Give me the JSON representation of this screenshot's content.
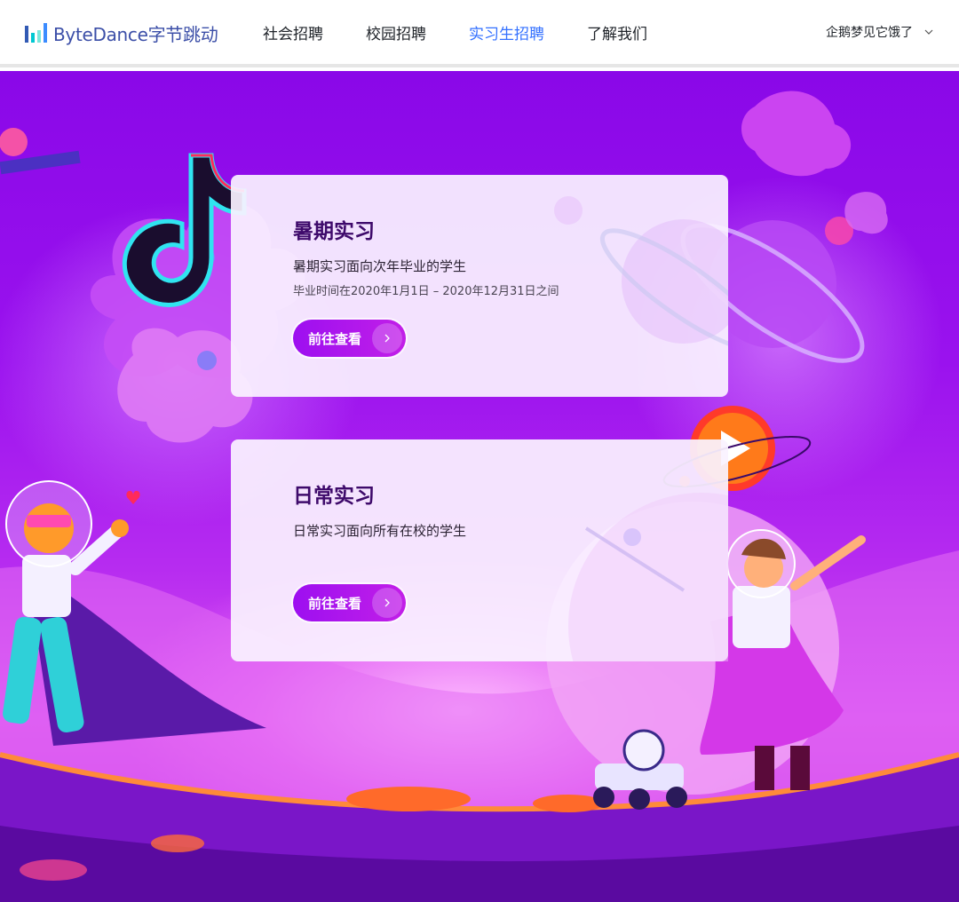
{
  "header": {
    "logo": {
      "text": "ByteDance字节跳动",
      "icon": "bytedance-logo-icon"
    },
    "nav": [
      {
        "label": "社会招聘",
        "active": false
      },
      {
        "label": "校园招聘",
        "active": false
      },
      {
        "label": "实习生招聘",
        "active": true
      },
      {
        "label": "了解我们",
        "active": false
      }
    ],
    "user": {
      "name": "企鹅梦见它饿了",
      "icon": "chevron-down-icon"
    }
  },
  "cards": [
    {
      "title": "暑期实习",
      "description": "暑期实习面向次年毕业的学生",
      "subtext": "毕业时间在2020年1月1日 – 2020年12月31日之间",
      "button": "前往查看",
      "button_icon": "chevron-right-icon"
    },
    {
      "title": "日常实习",
      "description": "日常实习面向所有在校的学生",
      "button": "前往查看",
      "button_icon": "chevron-right-icon"
    }
  ],
  "colors": {
    "accent": "#3370ff",
    "background_purple": "#9a12ee",
    "button": "#b01aec",
    "card_title": "#3e0a6b"
  }
}
